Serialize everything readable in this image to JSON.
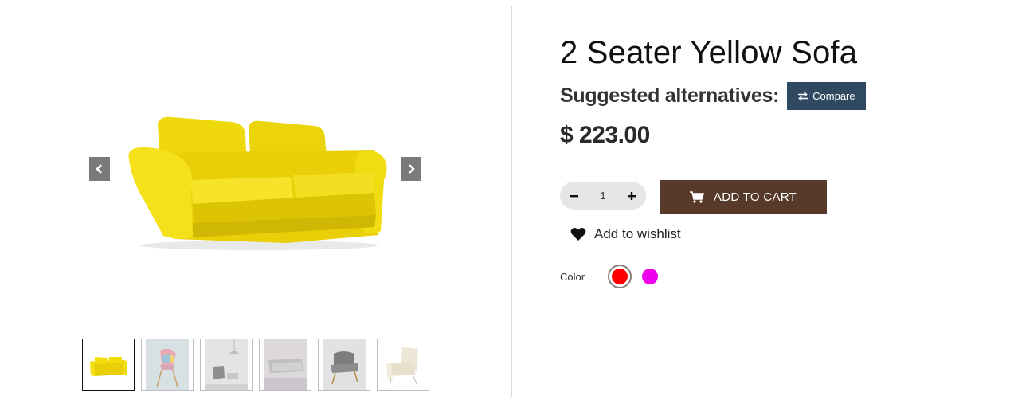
{
  "product": {
    "title": "2 Seater Yellow Sofa",
    "alternatives_label": "Suggested alternatives:",
    "compare_label": "Compare",
    "price": "$ 223.00"
  },
  "cart": {
    "quantity": "1",
    "add_to_cart_label": "ADD TO CART",
    "wishlist_label": "Add to wishlist"
  },
  "options": {
    "color_label": "Color",
    "colors": [
      {
        "name": "red",
        "hex": "#ff0000",
        "selected": true
      },
      {
        "name": "magenta",
        "hex": "#ee00ee",
        "selected": false
      }
    ]
  },
  "gallery": {
    "thumbnails": [
      "yellow-sofa",
      "patchwork-chair",
      "grey-armchair-room",
      "grey-sofa",
      "grey-armchair",
      "cream-armchair"
    ],
    "active_index": 0
  },
  "colors": {
    "compare_bg": "#2f4a60",
    "add_to_cart_bg": "#573a2a",
    "qty_bg": "#e6e6e6",
    "sofa_yellow": "#f2dd0a"
  }
}
